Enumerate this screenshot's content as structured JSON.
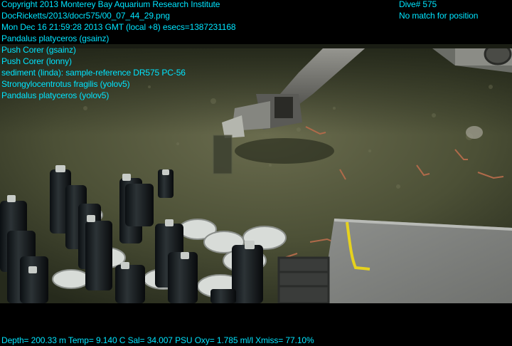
{
  "header": {
    "copyright": "Copyright 2013 Monterey Bay Aquarium Research Institute",
    "filename": "DocRicketts/2013/docr575/00_07_44_29.png",
    "timestamp": "Mon Dec 16 21:59:28 2013 GMT (local +8)  esecs=1387231168"
  },
  "annotations": [
    "Pandalus platyceros (gsainz)",
    "Push Corer (gsainz)",
    "Push Corer (lonny)",
    "sediment (linda): sample-reference DR575 PC-56",
    "Strongylocentrotus fragilis (yolov5)",
    "Pandalus platyceros (yolov5)"
  ],
  "dive": {
    "number": "Dive# 575",
    "position_status": "No match for position"
  },
  "telemetry": "Depth= 200.33 m  Temp= 9.140 C  Sal= 34.007 PSU  Oxy= 1.785 ml/l  Xmiss= 77.10%",
  "colors": {
    "overlay_text": "#00e5ff",
    "seafloor": "#4e5238"
  }
}
